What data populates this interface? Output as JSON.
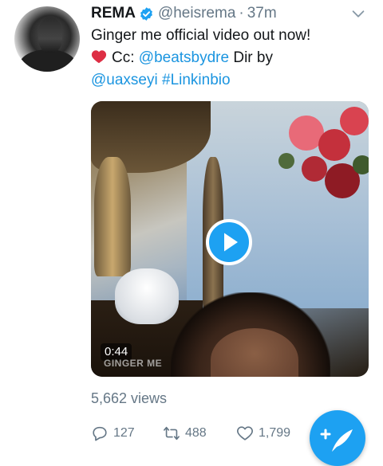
{
  "tweet": {
    "author_name": "REMA",
    "handle": "@heisrema",
    "separator": "·",
    "time": "37m",
    "text_line1": "Ginger me official video out now!",
    "cc_label": "Cc:",
    "mention_beats": "@beatsbydre",
    "dir_label": "Dir by",
    "mention_director": "@uaxseyi",
    "hashtag": "#Linkinbio"
  },
  "media": {
    "duration": "0:44",
    "watermark": "GINGER ME"
  },
  "stats": {
    "views": "5,662 views",
    "replies": "127",
    "retweets": "488",
    "likes": "1,799"
  },
  "colors": {
    "link": "#1b95e0",
    "verified": "#1da1f2",
    "secondary_text": "#657786",
    "fab": "#1da1f2",
    "heart_emoji": "#dd2e44"
  },
  "icons": {
    "verified": "verified-badge-icon",
    "caret": "chevron-down-icon",
    "play": "play-icon",
    "reply": "reply-icon",
    "retweet": "retweet-icon",
    "like": "heart-icon",
    "compose": "compose-tweet-icon"
  }
}
